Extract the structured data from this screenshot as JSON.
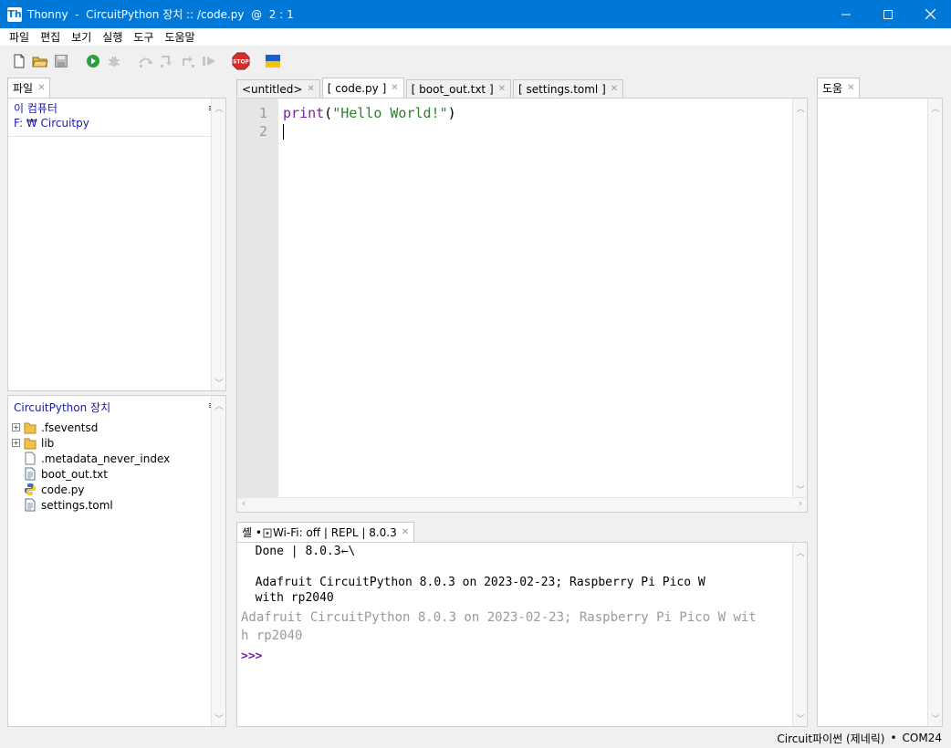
{
  "window": {
    "title": "Thonny  -  CircuitPython 장치 :: /code.py  @  2 : 1",
    "icon": "thonny-icon",
    "controls": [
      "minimize",
      "maximize",
      "close"
    ]
  },
  "menu": [
    "파일",
    "편집",
    "보기",
    "실행",
    "도구",
    "도움말"
  ],
  "toolbar": {
    "buttons": [
      "new-file",
      "open-file",
      "save-file",
      "run",
      "debug",
      "step-over",
      "step-into",
      "step-out",
      "resume",
      "stop",
      "ukraine-flag"
    ],
    "stop_label": "STOP"
  },
  "files_panel": {
    "tab": "파일",
    "local_header": "이 컴퓨터",
    "local_path": "F: ₩ Circuitpy",
    "device_header": "CircuitPython 장치",
    "device_files": [
      {
        "name": ".fseventsd",
        "type": "folder",
        "expandable": true
      },
      {
        "name": "lib",
        "type": "folder",
        "expandable": true
      },
      {
        "name": ".metadata_never_index",
        "type": "file"
      },
      {
        "name": "boot_out.txt",
        "type": "text"
      },
      {
        "name": "code.py",
        "type": "python"
      },
      {
        "name": "settings.toml",
        "type": "text"
      }
    ]
  },
  "editor": {
    "tabs": [
      "<untitled>",
      "[ code.py ]",
      "[ boot_out.txt ]",
      "[ settings.toml ]"
    ],
    "active_tab": 1,
    "line_numbers": [
      "1",
      "2"
    ],
    "code": {
      "fn": "print",
      "open": "(",
      "arg": "\"Hello World!\"",
      "close": ")"
    }
  },
  "shell": {
    "tab": "셸 • ",
    "tab_status": "Wi-Fi: off | REPL | 8.0.3",
    "lines": [
      "  Done | 8.0.3←\\",
      "",
      "  Adafruit CircuitPython 8.0.3 on 2023-02-23; Raspberry Pi Pico W",
      "  with rp2040"
    ],
    "gray_lines": [
      "Adafruit CircuitPython 8.0.3 on 2023-02-23; Raspberry Pi Pico W wit",
      "h rp2040"
    ],
    "prompt": ">>>"
  },
  "help_panel": {
    "tab": "도움"
  },
  "status": {
    "interpreter": "Circuit파이썬 (제네릭)",
    "separator": "•",
    "port": "COM24"
  }
}
